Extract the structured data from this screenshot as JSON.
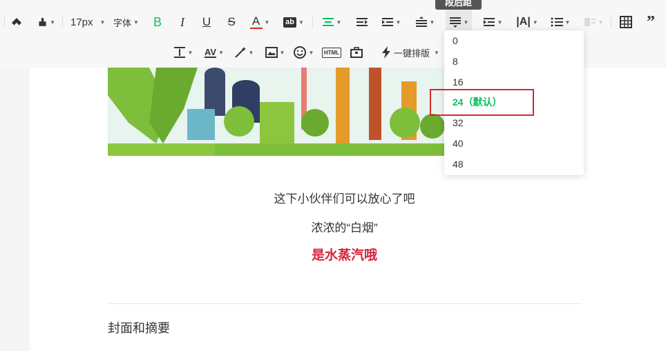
{
  "toolbar": {
    "font_size": "17px",
    "font_family": "字体",
    "bold": "B",
    "italic": "I",
    "underline": "U",
    "strike": "S",
    "font_color": "A",
    "bg_color_label": "ab",
    "html_label": "HTML",
    "one_key_layout": "一键排版",
    "tooltip": "段后距"
  },
  "dropdown": {
    "items": [
      "0",
      "8",
      "16",
      "24（默认）",
      "32",
      "40",
      "48"
    ],
    "selected_index": 3
  },
  "article": {
    "line1": "这下小伙伴们可以放心了吧",
    "line2": "浓浓的“白烟”",
    "line3": "是水蒸汽哦",
    "cover_heading": "封面和摘要"
  },
  "colors": {
    "accent": "#07c160",
    "highlight_text": "#d6243d",
    "annotation_box": "#d8262c"
  }
}
